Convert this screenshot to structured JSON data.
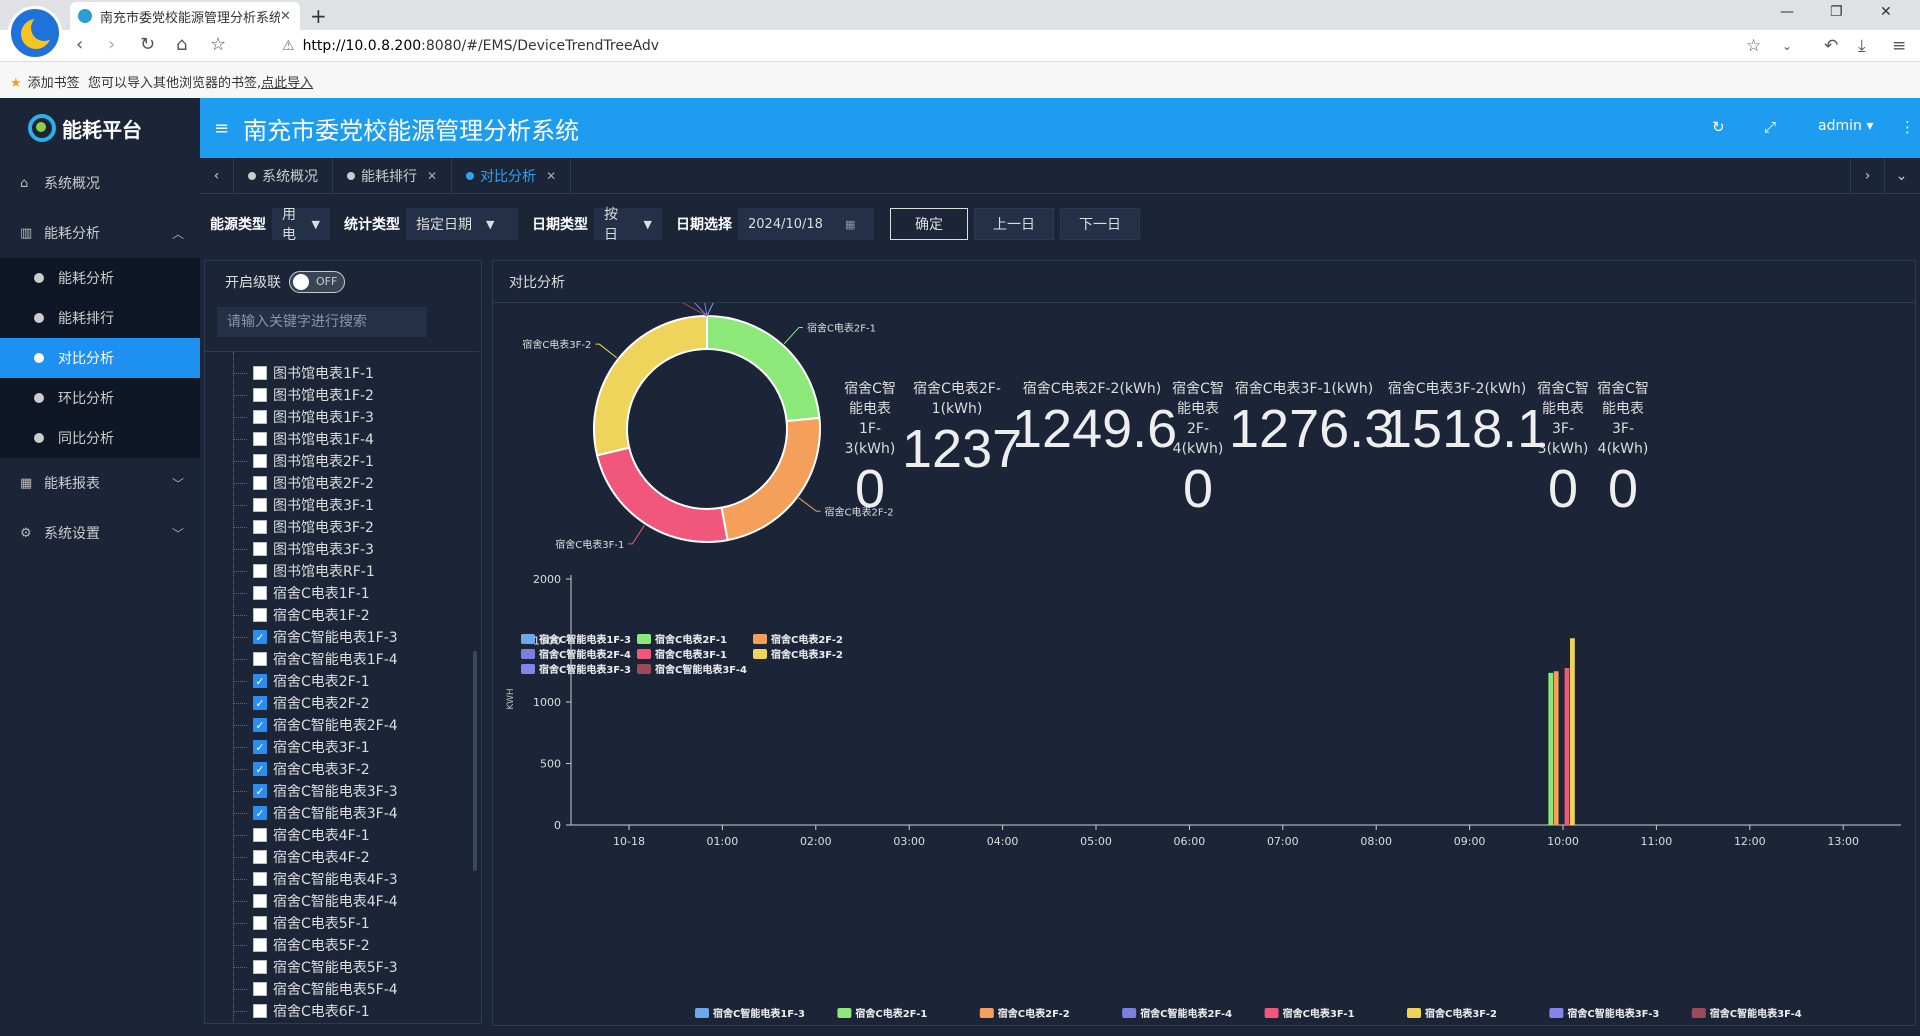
{
  "browser": {
    "tab_title": "南充市委党校能源管理分析系统",
    "url_host": "http://10.0.8.200",
    "url_rest": ":8080/#/EMS/DeviceTrendTreeAdv",
    "bookmark_add": "添加书签",
    "bookmark_hint": "您可以导入其他浏览器的书签,",
    "bookmark_link": "点此导入"
  },
  "app": {
    "logo_text": "能耗平台",
    "title": "南充市委党校能源管理分析系统",
    "user": "admin"
  },
  "sidebar": {
    "system_overview": "系统概况",
    "energy_analysis": "能耗分析",
    "sub_items": [
      "能耗分析",
      "能耗排行",
      "对比分析",
      "环比分析",
      "同比分析"
    ],
    "energy_report": "能耗报表",
    "settings": "系统设置"
  },
  "tabs": [
    "系统概况",
    "能耗排行",
    "对比分析"
  ],
  "filters": {
    "energy_type_label": "能源类型",
    "energy_type_value": "用电",
    "stat_type_label": "统计类型",
    "stat_type_value": "指定日期",
    "date_type_label": "日期类型",
    "date_type_value": "按日",
    "date_label": "日期选择",
    "date_value": "2024/10/18",
    "confirm": "确定",
    "prev": "上一日",
    "next": "下一日"
  },
  "tree": {
    "cascade_label": "开启级联",
    "switch_state": "OFF",
    "search_placeholder": "请输入关键字进行搜索",
    "nodes": [
      {
        "label": "图书馆电表1F-1",
        "checked": false
      },
      {
        "label": "图书馆电表1F-2",
        "checked": false
      },
      {
        "label": "图书馆电表1F-3",
        "checked": false
      },
      {
        "label": "图书馆电表1F-4",
        "checked": false
      },
      {
        "label": "图书馆电表2F-1",
        "checked": false
      },
      {
        "label": "图书馆电表2F-2",
        "checked": false
      },
      {
        "label": "图书馆电表3F-1",
        "checked": false
      },
      {
        "label": "图书馆电表3F-2",
        "checked": false
      },
      {
        "label": "图书馆电表3F-3",
        "checked": false
      },
      {
        "label": "图书馆电表RF-1",
        "checked": false
      },
      {
        "label": "宿舍C电表1F-1",
        "checked": false
      },
      {
        "label": "宿舍C电表1F-2",
        "checked": false
      },
      {
        "label": "宿舍C智能电表1F-3",
        "checked": true
      },
      {
        "label": "宿舍C智能电表1F-4",
        "checked": false
      },
      {
        "label": "宿舍C电表2F-1",
        "checked": true
      },
      {
        "label": "宿舍C电表2F-2",
        "checked": true
      },
      {
        "label": "宿舍C智能电表2F-4",
        "checked": true
      },
      {
        "label": "宿舍C电表3F-1",
        "checked": true
      },
      {
        "label": "宿舍C电表3F-2",
        "checked": true
      },
      {
        "label": "宿舍C智能电表3F-3",
        "checked": true
      },
      {
        "label": "宿舍C智能电表3F-4",
        "checked": true
      },
      {
        "label": "宿舍C电表4F-1",
        "checked": false
      },
      {
        "label": "宿舍C电表4F-2",
        "checked": false
      },
      {
        "label": "宿舍C智能电表4F-3",
        "checked": false
      },
      {
        "label": "宿舍C智能电表4F-4",
        "checked": false
      },
      {
        "label": "宿舍C电表5F-1",
        "checked": false
      },
      {
        "label": "宿舍C电表5F-2",
        "checked": false
      },
      {
        "label": "宿舍C智能电表5F-3",
        "checked": false
      },
      {
        "label": "宿舍C智能电表5F-4",
        "checked": false
      },
      {
        "label": "宿舍C电表6F-1",
        "checked": false
      }
    ]
  },
  "panel_title": "对比分析",
  "stats": [
    {
      "label": "宿舍C智能电表1F-3(kWh)",
      "value": "0"
    },
    {
      "label": "宿舍C电表2F-1(kWh)",
      "value": "1237"
    },
    {
      "label": "宿舍C电表2F-2(kWh)",
      "value": "1249.6"
    },
    {
      "label": "宿舍C智能电表2F-4(kWh)",
      "value": "0"
    },
    {
      "label": "宿舍C电表3F-1(kWh)",
      "value": "1276.3"
    },
    {
      "label": "宿舍C电表3F-2(kWh)",
      "value": "1518.1"
    },
    {
      "label": "宿舍C智能电表3F-3(kWh)",
      "value": "0"
    },
    {
      "label": "宿舍C智能电表3F-4(kWh)",
      "value": "0"
    }
  ],
  "colors": {
    "1F-3": "#6fa8e8",
    "2F-1": "#8de87a",
    "2F-2": "#f5a05a",
    "2F-4": "#7b7fe0",
    "3F-1": "#f0577a",
    "3F-2": "#eed45a",
    "3F-3": "#8584e8",
    "3F-4": "#9c4a5a"
  },
  "chart_data": [
    {
      "type": "pie",
      "donut": true,
      "labels": [
        "宿舍C智能电表1F-3",
        "宿舍C电表2F-1",
        "宿舍C电表2F-2",
        "宿舍C智能电表2F-4",
        "宿舍C电表3F-1",
        "宿舍C电表3F-2",
        "宿舍C智能电表3F-3",
        "宿舍C智能电表3F-4"
      ],
      "values": [
        0,
        1237,
        1249.6,
        0,
        1276.3,
        1518.1,
        0,
        0
      ],
      "legend": "bottom-left"
    },
    {
      "type": "bar",
      "ylabel": "KWH",
      "ylim": [
        0,
        2000
      ],
      "yticks": [
        0,
        500,
        1000,
        1500,
        2000
      ],
      "xticks": [
        "10-18",
        "01:00",
        "02:00",
        "03:00",
        "04:00",
        "05:00",
        "06:00",
        "07:00",
        "08:00",
        "09:00",
        "10:00",
        "11:00",
        "12:00",
        "13:00"
      ],
      "category": "10:00",
      "series": [
        {
          "name": "宿舍C智能电表1F-3",
          "values": [
            0
          ]
        },
        {
          "name": "宿舍C电表2F-1",
          "values": [
            1237
          ]
        },
        {
          "name": "宿舍C电表2F-2",
          "values": [
            1249.6
          ]
        },
        {
          "name": "宿舍C智能电表2F-4",
          "values": [
            0
          ]
        },
        {
          "name": "宿舍C电表3F-1",
          "values": [
            1276.3
          ]
        },
        {
          "name": "宿舍C电表3F-2",
          "values": [
            1518.1
          ]
        },
        {
          "name": "宿舍C智能电表3F-3",
          "values": [
            0
          ]
        },
        {
          "name": "宿舍C智能电表3F-4",
          "values": [
            0
          ]
        }
      ],
      "legend": "bottom"
    }
  ]
}
